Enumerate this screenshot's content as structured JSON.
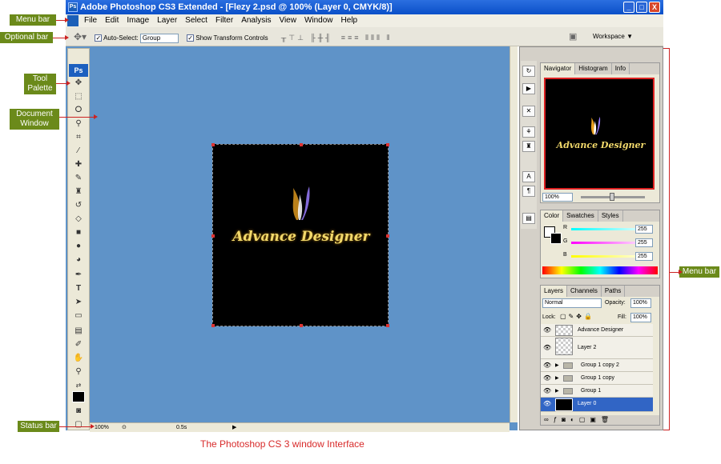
{
  "window": {
    "title": "Adobe Photoshop CS3 Extended - [Flezy 2.psd @ 100% (Layer 0, CMYK/8)]",
    "min": "_",
    "max": "□",
    "close": "X"
  },
  "menu": [
    "File",
    "Edit",
    "Image",
    "Layer",
    "Select",
    "Filter",
    "Analysis",
    "View",
    "Window",
    "Help"
  ],
  "options": {
    "auto_select_label": "Auto-Select:",
    "auto_select_value": "Group",
    "show_transform_label": "Show Transform Controls",
    "workspace_label": "Workspace ▼"
  },
  "toolbox": {
    "logo": "Ps"
  },
  "document": {
    "logo_text": "Advance Designer"
  },
  "status": {
    "zoom": "100%",
    "info": "0.5s"
  },
  "navigator": {
    "tabs": [
      "Navigator",
      "Histogram",
      "Info"
    ],
    "zoom": "100%",
    "logo_text": "Advance Designer"
  },
  "color": {
    "tabs": [
      "Color",
      "Swatches",
      "Styles"
    ],
    "r_label": "R",
    "g_label": "G",
    "b_label": "B",
    "r": "255",
    "g": "255",
    "b": "255"
  },
  "layers": {
    "tabs": [
      "Layers",
      "Channels",
      "Paths"
    ],
    "blend_mode": "Normal",
    "opacity_label": "Opacity:",
    "opacity": "100%",
    "lock_label": "Lock:",
    "fill_label": "Fill:",
    "fill": "100%",
    "rows": [
      "Advance Designer",
      "Layer 2",
      "Group 1 copy 2",
      "Group 1 copy",
      "Group 1",
      "Layer 0"
    ]
  },
  "annotations": {
    "menu_bar": "Menu bar",
    "optional_bar": "Optional bar",
    "tool_palette": "Tool Palette",
    "document_window": "Document Window",
    "status_bar": "Status bar",
    "menu_bar_right": "Menu bar"
  },
  "caption": "The Photoshop CS 3  window Interface",
  "colors": {
    "workspace": "#5f93c8",
    "annotation": "#6b8a1a",
    "arrow": "#cc2222",
    "caption": "#d82a2a"
  }
}
